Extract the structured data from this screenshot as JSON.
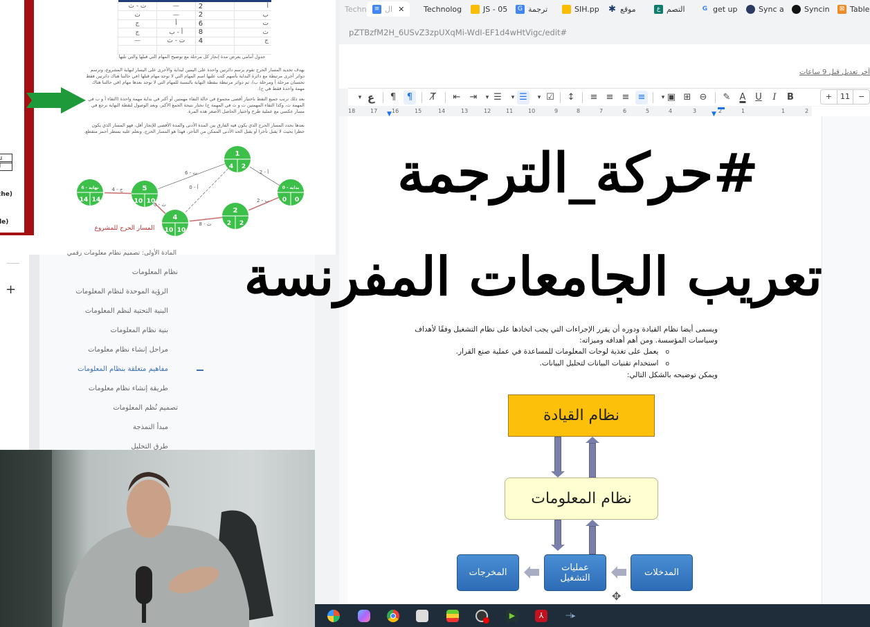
{
  "browser": {
    "tabs": [
      {
        "label": "Techn",
        "icon": "generic-tab-icon",
        "active": false
      },
      {
        "label": "ال",
        "icon": "google-docs-icon",
        "active": true,
        "close": "✕"
      },
      {
        "label": "Technolog",
        "icon": "none",
        "active": false
      },
      {
        "label": "JS - 05",
        "icon": "google-slides-icon",
        "active": false
      },
      {
        "label": "ترجمة",
        "icon": "google-translate-icon",
        "active": false
      },
      {
        "label": "SIH.pp",
        "icon": "google-slides-icon",
        "active": false
      },
      {
        "label": "موقع",
        "icon": "site-icon",
        "active": false
      },
      {
        "label": "التصم",
        "icon": "app-icon",
        "active": false
      },
      {
        "label": "get up",
        "icon": "google-icon",
        "active": false
      },
      {
        "label": "Sync a",
        "icon": "globe-icon",
        "active": false
      },
      {
        "label": "Syncin",
        "icon": "github-icon",
        "active": false
      },
      {
        "label": "Tablea",
        "icon": "xampp-icon",
        "active": false
      }
    ],
    "url": "pZTBzfM2H_6USvZ3zpUXqMi-WdI-EF1d4wHtVigc/edit#"
  },
  "doc": {
    "last_edit": "آخر تعديل قبل 9 ساعات",
    "toolbar": {
      "font_size": "11",
      "increase": "+",
      "decrease": "−",
      "items": [
        "bold",
        "italic",
        "underline",
        "text-color",
        "highlight",
        "link",
        "comment",
        "image",
        "align-right",
        "align-center",
        "align-left",
        "align-justify",
        "line-spacing",
        "checklist",
        "bulleted-list",
        "numbered-list",
        "indent-decrease",
        "indent-increase",
        "clear-formatting",
        "ltr",
        "rtl",
        "spellcheck"
      ]
    },
    "ruler": [
      "18",
      "17",
      "16",
      "15",
      "14",
      "13",
      "12",
      "11",
      "10",
      "9",
      "8",
      "7",
      "6",
      "5",
      "4",
      "3",
      "2",
      "1",
      "1",
      "2"
    ],
    "overlay_title_1": "#حركة_الترجمة",
    "overlay_title_2": "تعريب الجامعات المفرنسة",
    "body": {
      "para1": "ويسمى أيضا نظام القيادة ودوره أن يقرر الإجراءات التي يجب اتخاذها على نظام التشغيل وفقًا لأهداف وسياسات المؤسسة. ومن أهم أهدافه وميزاته:",
      "bullets": [
        "يعمل على تغذية لوحات المعلومات للمساعدة في عملية صنع القرار.",
        "استخدام تقنيات البيانات لتحليل البيانات."
      ],
      "para2": "ويمكن توضيحه بالشكل التالي:"
    },
    "diagram": {
      "leadership": "نظام القيادة",
      "info_system": "نظام المعلومات",
      "inputs": "المدخلات",
      "operations_line1": "عمليات",
      "operations_line2": "التشغيل",
      "outputs": "المخرجات",
      "colors": {
        "leadership": "#fcc00b",
        "info_system": "#fefed0",
        "blue": "#2d6cb6",
        "arrow": "#7a7fa9"
      }
    }
  },
  "left_doc": {
    "edge_cells": [
      "au",
      "rd"
    ],
    "edge_arrows": [
      "che)",
      "lle)"
    ],
    "table": [
      [
        "أ",
        "2",
        "—",
        "ت - ث"
      ],
      [
        "ب",
        "2",
        "—",
        "ث"
      ],
      [
        "ت",
        "6",
        "أ",
        "ج"
      ],
      [
        "ث",
        "8",
        "أ - ب",
        "ج"
      ],
      [
        "ج",
        "4",
        "ت - ث",
        "—"
      ]
    ],
    "caption": "جدول أمامي يعرض مدة إنجاز كل مرحلة مع توضيح المهام التي قبلها والتي تليها",
    "para1": "يهدف تحديد المسار الحرج تقوم برسم دائرتين واحدة على اليمين لبداية والأخرى على اليسار لنهاية المشروع، وترسم دوائر أخرى مرتبطة مع دائرة البداية بأسهم كتب عليها اسم المهام التي لا توجد مهام قبلها (في حالتنا هناك دائرتين فقط تحسبان مرحلة أ ومرحلة ب)، ثم دوائر مرتبطة بنقطة النهاية بالنسبة للمهام التي لا توجد بعدها مهام (في حالتنا هناك مهمة واحدة فقط هي ج).",
    "para2": "بعد ذلك نرتب جميع النقط باختيار أقصى مجموع في حالة التقاء مهمتين أو أكثر في بداية مهمة واحدة (التقاء أ و ب في المهمة ث، وكذا التقاء المهمتين ت و ث في المهمة ج) نختار نتيجة الجمع الأكبر، وبعد الوصول لنقطة النهاية نرجع في مسار عكسي مع عملية طرح واختيار الحاصل الأصغر هذه المرة.",
    "para3": "بعدها نحدد المسار الحرج الذي يكون فيه الفارق بين المدة الأدنى والمدة الأقصى للإنجاز أقل، فهو المسار الذي يكون خطرا بحيث لا يقبل تأخرا أو يقبل الحد الأدنى الممكن من التأخر، فهذا هو المسار الحرج، ونعلم عليه بسطر أحمر متقطع.",
    "network": {
      "nodes": [
        {
          "id": "0",
          "label": "0 - بداية",
          "left": "0",
          "right": "0"
        },
        {
          "id": "1",
          "label": "1",
          "left": "4",
          "right": "2"
        },
        {
          "id": "2",
          "label": "2",
          "left": "2",
          "right": "2"
        },
        {
          "id": "4",
          "label": "4",
          "left": "10",
          "right": "10"
        },
        {
          "id": "5",
          "label": "5",
          "left": "10",
          "right": "10"
        },
        {
          "id": "6",
          "label": "6 - نهاية",
          "left": "14",
          "right": "14"
        }
      ],
      "edges": [
        {
          "from": "0",
          "to": "1",
          "label": "أ - 2"
        },
        {
          "from": "0",
          "to": "2",
          "label": "ب - 2"
        },
        {
          "from": "1",
          "to": "5",
          "label": "ت - 6"
        },
        {
          "from": "1",
          "to": "4",
          "label": "أ - 0"
        },
        {
          "from": "2",
          "to": "4",
          "label": "ث - 8"
        },
        {
          "from": "4",
          "to": "5",
          "label": "ث - 0"
        },
        {
          "from": "5",
          "to": "6",
          "label": "ج - 4"
        }
      ],
      "critical_path_label": "المسار الحرج للمشروع",
      "node_color": "#3cc04a"
    }
  },
  "outline": {
    "add_label": "+",
    "items": [
      {
        "label": "المادة الأولى: تصميم نظام معلومات رقمي",
        "active": false
      },
      {
        "label": "نظام المعلومات",
        "active": false
      },
      {
        "label": "الرؤية الموحدة لنظام المعلومات",
        "active": false
      },
      {
        "label": "البنية التحتية لنظم المعلومات",
        "active": false
      },
      {
        "label": "بنية نظام المعلومات",
        "active": false
      },
      {
        "label": "مراحل إنشاء نظام معلومات",
        "active": false
      },
      {
        "label": "مفاهيم متعلقة بنظام المعلومات",
        "active": true
      },
      {
        "label": "طريقة إنشاء نظام معلومات",
        "active": false
      },
      {
        "label": "تصميم نُظم المعلومات",
        "active": false
      },
      {
        "label": "مبدأ النمذجة",
        "active": false
      },
      {
        "label": "طرق التحليل",
        "active": false
      }
    ]
  },
  "webcam": {
    "description": "presenter video overlay"
  },
  "taskbar": {
    "apps": [
      "widgets-icon",
      "copilot-icon",
      "chrome-icon",
      "photo-app-icon",
      "bluestacks-icon",
      "obs-icon",
      "media-player-icon",
      "acrobat-icon",
      "audio-tool-icon"
    ]
  }
}
